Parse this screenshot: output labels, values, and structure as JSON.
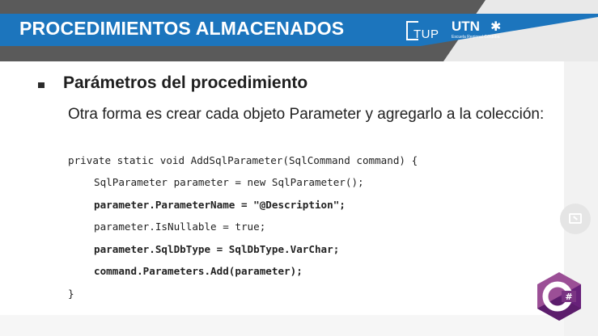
{
  "header": {
    "title": "PROCEDIMIENTOS ALMACENADOS",
    "logo_tup": "TUP",
    "logo_utn": "UTN",
    "logo_utn_sub": "Escuela Regional Córdoba"
  },
  "content": {
    "heading": "Parámetros del procedimiento",
    "paragraph": "Otra forma es crear cada objeto Parameter y agregarlo a la colección:",
    "code_lines": [
      "private static void AddSqlParameter(SqlCommand command) {",
      "SqlParameter parameter = new SqlParameter();",
      "parameter.ParameterName = \"@Description\";",
      "parameter.IsNullable = true;",
      "parameter.SqlDbType = SqlDbType.VarChar;",
      "command.Parameters.Add(parameter);",
      "}"
    ]
  },
  "logo_csharp": "C#",
  "colors": {
    "header_blue": "#1c75bd",
    "header_dark": "#5a5a5a",
    "csharp_purple": "#68217a"
  },
  "icons": [
    "bullet-square-icon",
    "picture-in-picture-icon",
    "csharp-logo-icon"
  ]
}
